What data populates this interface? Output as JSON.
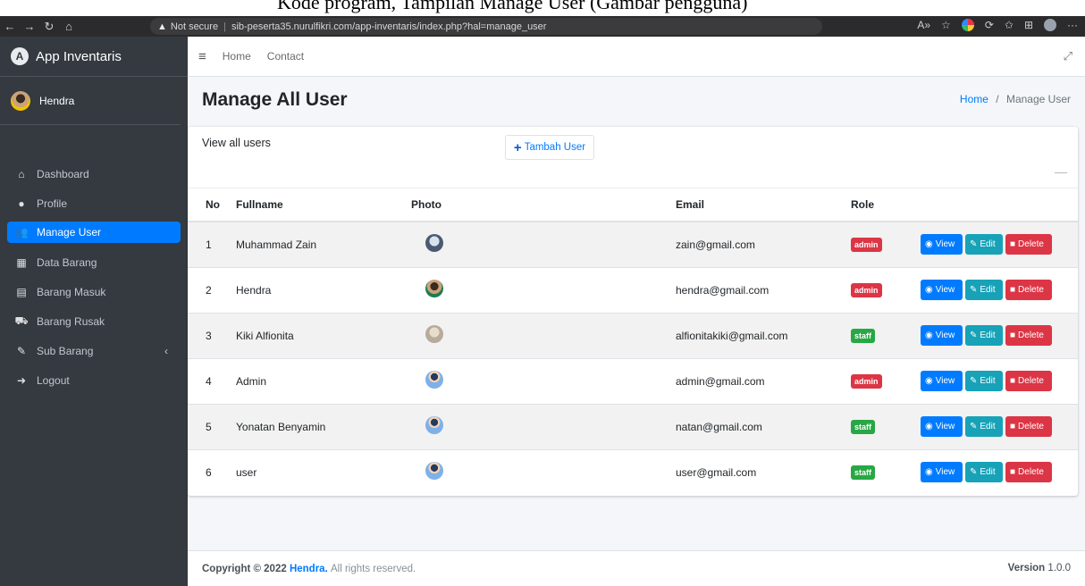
{
  "doc_caption": "Kode program, Tampilan Manage User (Gambar pengguna)",
  "browser": {
    "security": "Not secure",
    "url": "sib-peserta35.nurulfikri.com/app-inventaris/index.php?hal=manage_user"
  },
  "sidebar": {
    "brand": "App Inventaris",
    "user": "Hendra",
    "items": [
      {
        "label": "Dashboard",
        "icon": "home-icon"
      },
      {
        "label": "Profile",
        "icon": "user-icon"
      },
      {
        "label": "Manage User",
        "icon": "users-icon",
        "active": true
      },
      {
        "label": "Data Barang",
        "icon": "boxes-icon"
      },
      {
        "label": "Barang Masuk",
        "icon": "dolly-icon"
      },
      {
        "label": "Barang Rusak",
        "icon": "truck-icon"
      },
      {
        "label": "Sub Barang",
        "icon": "edit-icon"
      },
      {
        "label": "Logout",
        "icon": "logout-icon"
      }
    ]
  },
  "navbar": {
    "home": "Home",
    "contact": "Contact"
  },
  "page": {
    "title": "Manage All User",
    "breadcrumb_home": "Home",
    "breadcrumb_current": "Manage User"
  },
  "card": {
    "title": "View all users",
    "add_button": "Tambah User"
  },
  "table": {
    "headers": {
      "no": "No",
      "fullname": "Fullname",
      "photo": "Photo",
      "email": "Email",
      "role": "Role"
    },
    "rows": [
      {
        "no": "1",
        "fullname": "Muhammad Zain",
        "email": "zain@gmail.com",
        "role": "admin"
      },
      {
        "no": "2",
        "fullname": "Hendra",
        "email": "hendra@gmail.com",
        "role": "admin"
      },
      {
        "no": "3",
        "fullname": "Kiki Alfionita",
        "email": "alfionitakiki@gmail.com",
        "role": "staff"
      },
      {
        "no": "4",
        "fullname": "Admin",
        "email": "admin@gmail.com",
        "role": "admin"
      },
      {
        "no": "5",
        "fullname": "Yonatan Benyamin",
        "email": "natan@gmail.com",
        "role": "staff"
      },
      {
        "no": "6",
        "fullname": "user",
        "email": "user@gmail.com",
        "role": "staff"
      }
    ],
    "actions": {
      "view": "View",
      "edit": "Edit",
      "delete": "Delete"
    }
  },
  "footer": {
    "copyright_prefix": "Copyright © 2022",
    "author": "Hendra.",
    "rights": "All rights reserved.",
    "version_label": "Version",
    "version": "1.0.0"
  },
  "colors": {
    "sidebar_bg": "#343a40",
    "primary": "#007bff",
    "info": "#17a2b8",
    "danger": "#dc3545",
    "success": "#28a745"
  }
}
